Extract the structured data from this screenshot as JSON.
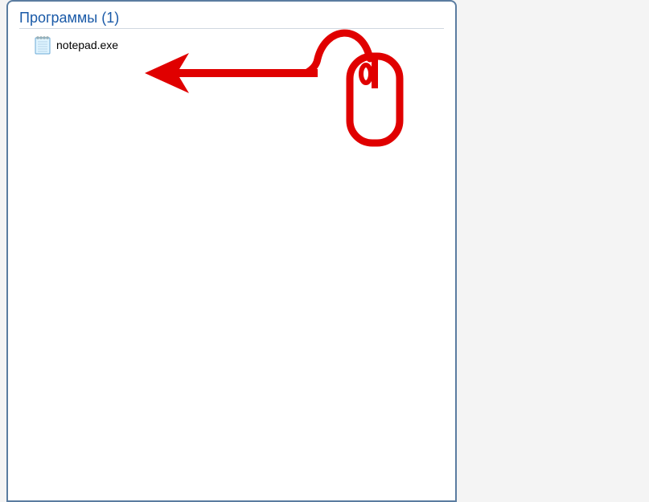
{
  "group": {
    "label": "Программы",
    "count": 1
  },
  "results": [
    {
      "icon": "notepad-icon",
      "label": "notepad.exe"
    }
  ],
  "annotation_color": "#e00000"
}
